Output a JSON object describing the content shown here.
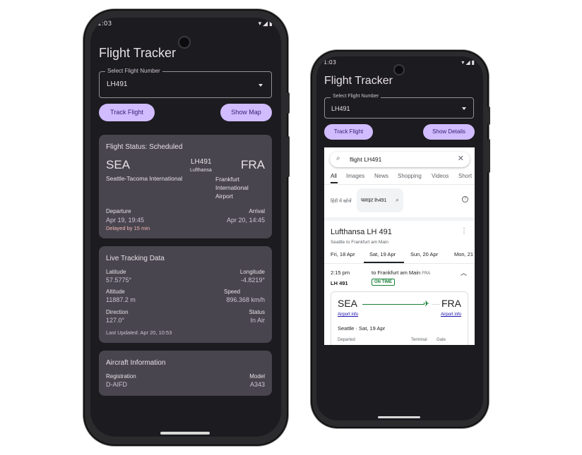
{
  "left_phone": {
    "status": {
      "time": "1:03"
    },
    "title": "Flight Tracker",
    "select": {
      "label": "Select Flight Number",
      "value": "LH491"
    },
    "buttons": {
      "track": "Track Flight",
      "map": "Show Map"
    },
    "status_card": {
      "title": "Flight Status: Scheduled",
      "origin_code": "SEA",
      "origin_name": "Seattle-Tacoma International",
      "flight_no": "LH491",
      "airline": "Lufthansa",
      "dest_code": "FRA",
      "dest_name": [
        "Frankfurt",
        "International",
        "Airport"
      ],
      "departure_label": "Departure",
      "departure_value": "Apr 19, 19:45",
      "delay": "Delayed by 15 min",
      "arrival_label": "Arrival",
      "arrival_value": "Apr 20, 14:45"
    },
    "tracking_card": {
      "title": "Live Tracking Data",
      "latitude_label": "Latitude",
      "latitude_value": "57.5775°",
      "longitude_label": "Longitude",
      "longitude_value": "-4.8219°",
      "altitude_label": "Altitude",
      "altitude_value": "11887.2 m",
      "speed_label": "Speed",
      "speed_value": "896.368 km/h",
      "direction_label": "Direction",
      "direction_value": "127.0°",
      "status_label": "Status",
      "status_value": "In Air",
      "updated": "Last Updated: Apr 20, 10:53"
    },
    "aircraft_card": {
      "title": "Aircraft Information",
      "registration_label": "Registration",
      "registration_value": "D-AIFD",
      "model_label": "Model",
      "model_value": "A343"
    }
  },
  "right_phone": {
    "status": {
      "time": "1:03"
    },
    "title": "Flight Tracker",
    "select": {
      "label": "Select Flight Number",
      "value": "LH491"
    },
    "buttons": {
      "track": "Track Flight",
      "details": "Show Details"
    },
    "google": {
      "query": "flight LH491",
      "tabs": [
        "All",
        "Images",
        "News",
        "Shopping",
        "Videos",
        "Short"
      ],
      "hindi_label": "हिंदी में खोजें",
      "hindi_chip": "फ्लाइट lh491",
      "result_title": "Lufthansa LH 491",
      "result_subtitle": "Seattle to Frankfurt am Main",
      "dates": [
        "Fri, 18 Apr",
        "Sat, 19 Apr",
        "Sun, 20 Apr",
        "Mon, 21"
      ],
      "time": "2:15 pm",
      "dest_line": "to Frankfurt am Main",
      "dest_code_small": "FRA",
      "flight": "LH 491",
      "badge": "ON TIME",
      "from_code": "SEA",
      "to_code": "FRA",
      "airport_info": "Airport info",
      "depart_line": "Seattle · Sat, 19 Apr",
      "col_departed": "Departed",
      "col_terminal": "Terminal",
      "col_gate": "Gate"
    }
  },
  "colors": {
    "background": "#1c1b1f",
    "card": "#49454f",
    "accent": "#d0bcff",
    "on_accent": "#381e72",
    "delay": "#f2b8b5",
    "on_time": "#188038"
  }
}
